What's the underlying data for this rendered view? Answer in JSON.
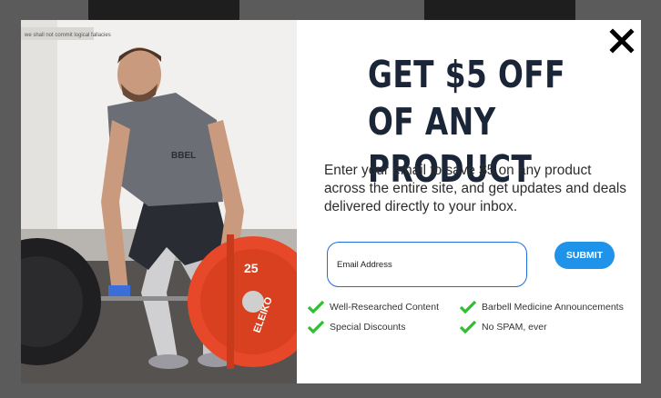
{
  "page": {
    "overlay_color": "#5b5b5b",
    "background_banner": "we shall not commit logical fallacies"
  },
  "popup": {
    "headline": [
      "GET $5 OFF",
      "OF ANY",
      "PRODUCT"
    ],
    "subtext": "Enter your email to save $5 on any product across the entire site, and get updates and deals delivered directly to your  inbox.",
    "email_placeholder": "Email Address",
    "submit_label": "SUBMIT",
    "close_icon": "close-x-icon",
    "benefits": [
      "Well-Researched Content",
      "Barbell Medicine Announcements",
      "Special Discounts",
      "No SPAM, ever"
    ],
    "benefit_icon": "checkmark-icon",
    "photo_plate_brand": "ELEIKO",
    "photo_plate_weight": "25",
    "photo_shirt_text": "BBEL",
    "colors": {
      "headline": "#1b2538",
      "submit": "#1f93ea",
      "input_border": "#1d6fe0",
      "check": "#2fbf2f",
      "plate": "#e8482a"
    }
  }
}
